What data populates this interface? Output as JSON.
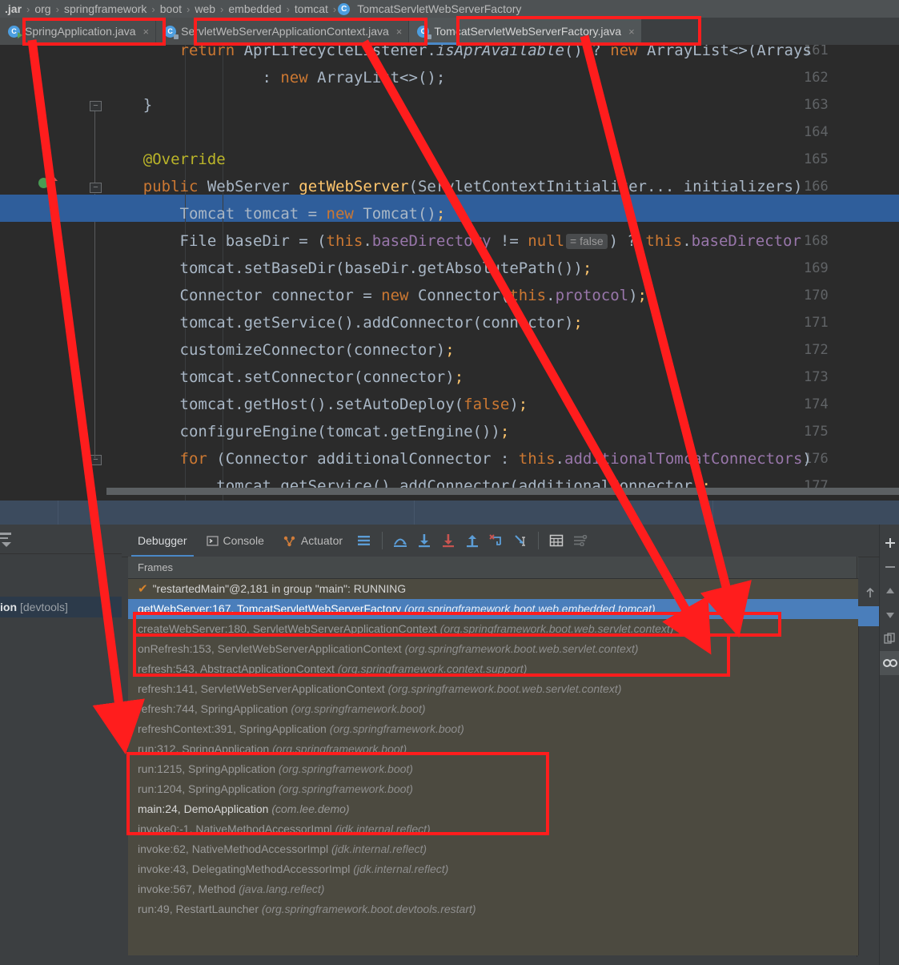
{
  "breadcrumb": {
    "items": [
      "boot-starter.jar",
      "org",
      "springframework",
      "boot",
      "web",
      "embedded",
      "tomcat",
      "TomcatServletWebServerFactory"
    ],
    "display": [
      ".jar",
      "org",
      "springframework",
      "boot",
      "web",
      "embedded",
      "tomcat",
      "TomcatServletWebServerFactory"
    ],
    "class_badge": "C",
    "separator": "›"
  },
  "tabs": [
    {
      "label": "SpringApplication.java",
      "icon": "java-class-run-icon",
      "active": false,
      "close": "×"
    },
    {
      "label": "ServletWebServerApplicationContext.java",
      "icon": "java-class-icon",
      "active": false,
      "close": "×"
    },
    {
      "label": "TomcatServletWebServerFactory.java",
      "icon": "java-class-icon",
      "active": true,
      "close": "×"
    }
  ],
  "editor": {
    "current_line": 167,
    "breakpoint_line": 167,
    "override_marker_line": 166,
    "lines": [
      {
        "no": "161",
        "text": "        return AprLifecycleListener.isAprAvailable() ? new ArrayList<>(Arrays"
      },
      {
        "no": "162",
        "text": "                : new ArrayList<>();"
      },
      {
        "no": "163",
        "text": "    }"
      },
      {
        "no": "164",
        "text": ""
      },
      {
        "no": "165",
        "text": "    @Override"
      },
      {
        "no": "166",
        "text": "    public WebServer getWebServer(ServletContextInitializer... initializers)"
      },
      {
        "no": "167",
        "text": "        Tomcat tomcat = new Tomcat();"
      },
      {
        "no": "168",
        "text": "        File baseDir = (this.baseDirectory != null = false ) ? this.baseDirector"
      },
      {
        "no": "169",
        "text": "        tomcat.setBaseDir(baseDir.getAbsolutePath());"
      },
      {
        "no": "170",
        "text": "        Connector connector = new Connector(this.protocol);"
      },
      {
        "no": "171",
        "text": "        tomcat.getService().addConnector(connector);"
      },
      {
        "no": "172",
        "text": "        customizeConnector(connector);"
      },
      {
        "no": "173",
        "text": "        tomcat.setConnector(connector);"
      },
      {
        "no": "174",
        "text": "        tomcat.getHost().setAutoDeploy(false);"
      },
      {
        "no": "175",
        "text": "        configureEngine(tomcat.getEngine());"
      },
      {
        "no": "176",
        "text": "        for (Connector additionalConnector : this.additionalTomcatConnectors)"
      },
      {
        "no": "177",
        "text": "            tomcat.getService().addConnector(additionalConnector);"
      }
    ],
    "inlay_hint": "= false"
  },
  "left_panel": {
    "selected_run_config": "ion",
    "selected_run_suffix": "[devtools]"
  },
  "debug_panel": {
    "tabs": [
      {
        "label": "Debugger",
        "icon": "debugger-icon",
        "selected": true
      },
      {
        "label": "Console",
        "icon": "console-icon",
        "selected": false
      },
      {
        "label": "Actuator",
        "icon": "actuator-icon",
        "selected": false
      }
    ],
    "toolbar_icons": [
      "layout-icon",
      "step-over-icon",
      "step-into-icon",
      "force-step-into-icon",
      "step-out-icon",
      "drop-frame-icon",
      "run-to-cursor-icon",
      "evaluate-expression-icon",
      "settings-icon"
    ],
    "frames_header": "Frames",
    "frames_toolbar_icons": [
      "arrow-up-icon",
      "arrow-down-icon",
      "filter-icon",
      "chevron-down-icon"
    ],
    "right_toolbar_icons": [
      "plus-icon",
      "minus-icon",
      "arrow-up-icon",
      "arrow-down-icon",
      "copy-icon",
      "watches-icon"
    ],
    "thread_row": {
      "icon": "checkmark-icon",
      "text": "\"restartedMain\"@2,181 in group \"main\": RUNNING"
    },
    "frames": [
      {
        "method": "getWebServer:167, TomcatServletWebServerFactory",
        "pkg": "(org.springframework.boot.web.embedded.tomcat)",
        "selected": true,
        "bright": false
      },
      {
        "method": "createWebServer:180, ServletWebServerApplicationContext",
        "pkg": "(org.springframework.boot.web.servlet.context)",
        "selected": false,
        "bright": false
      },
      {
        "method": "onRefresh:153, ServletWebServerApplicationContext",
        "pkg": "(org.springframework.boot.web.servlet.context)",
        "selected": false,
        "bright": false
      },
      {
        "method": "refresh:543, AbstractApplicationContext",
        "pkg": "(org.springframework.context.support)",
        "selected": false,
        "bright": false
      },
      {
        "method": "refresh:141, ServletWebServerApplicationContext",
        "pkg": "(org.springframework.boot.web.servlet.context)",
        "selected": false,
        "bright": false
      },
      {
        "method": "refresh:744, SpringApplication",
        "pkg": "(org.springframework.boot)",
        "selected": false,
        "bright": false
      },
      {
        "method": "refreshContext:391, SpringApplication",
        "pkg": "(org.springframework.boot)",
        "selected": false,
        "bright": false
      },
      {
        "method": "run:312, SpringApplication",
        "pkg": "(org.springframework.boot)",
        "selected": false,
        "bright": false
      },
      {
        "method": "run:1215, SpringApplication",
        "pkg": "(org.springframework.boot)",
        "selected": false,
        "bright": false
      },
      {
        "method": "run:1204, SpringApplication",
        "pkg": "(org.springframework.boot)",
        "selected": false,
        "bright": false
      },
      {
        "method": "main:24, DemoApplication",
        "pkg": "(com.lee.demo)",
        "selected": false,
        "bright": true
      },
      {
        "method": "invoke0:-1, NativeMethodAccessorImpl",
        "pkg": "(jdk.internal.reflect)",
        "selected": false,
        "bright": false
      },
      {
        "method": "invoke:62, NativeMethodAccessorImpl",
        "pkg": "(jdk.internal.reflect)",
        "selected": false,
        "bright": false
      },
      {
        "method": "invoke:43, DelegatingMethodAccessorImpl",
        "pkg": "(jdk.internal.reflect)",
        "selected": false,
        "bright": false
      },
      {
        "method": "invoke:567, Method",
        "pkg": "(java.lang.reflect)",
        "selected": false,
        "bright": false
      },
      {
        "method": "run:49, RestartLauncher",
        "pkg": "(org.springframework.boot.devtools.restart)",
        "selected": false,
        "bright": false
      }
    ]
  },
  "annotations": {
    "color": "#FF1D1D",
    "boxes": [
      {
        "name": "tab-1-highlight"
      },
      {
        "name": "tab-2-highlight"
      },
      {
        "name": "tab-3-highlight"
      },
      {
        "name": "selected-frame-highlight"
      },
      {
        "name": "context-frames-highlight"
      },
      {
        "name": "springapplication-frames-highlight"
      }
    ],
    "arrows": [
      {
        "name": "arrow-tab3-to-selected-frame"
      },
      {
        "name": "arrow-tab2-to-context-frames"
      },
      {
        "name": "arrow-tab1-to-springapplication-frames"
      }
    ]
  },
  "colors": {
    "accent_blue": "#4a88c7",
    "selection_blue": "#2f5e9b",
    "frame_selection": "#4a7ebb",
    "annotation_red": "#FF1D1D",
    "editor_bg": "#2b2b2b",
    "panel_bg": "#3c3f41",
    "frames_bg": "#4c4a40"
  }
}
